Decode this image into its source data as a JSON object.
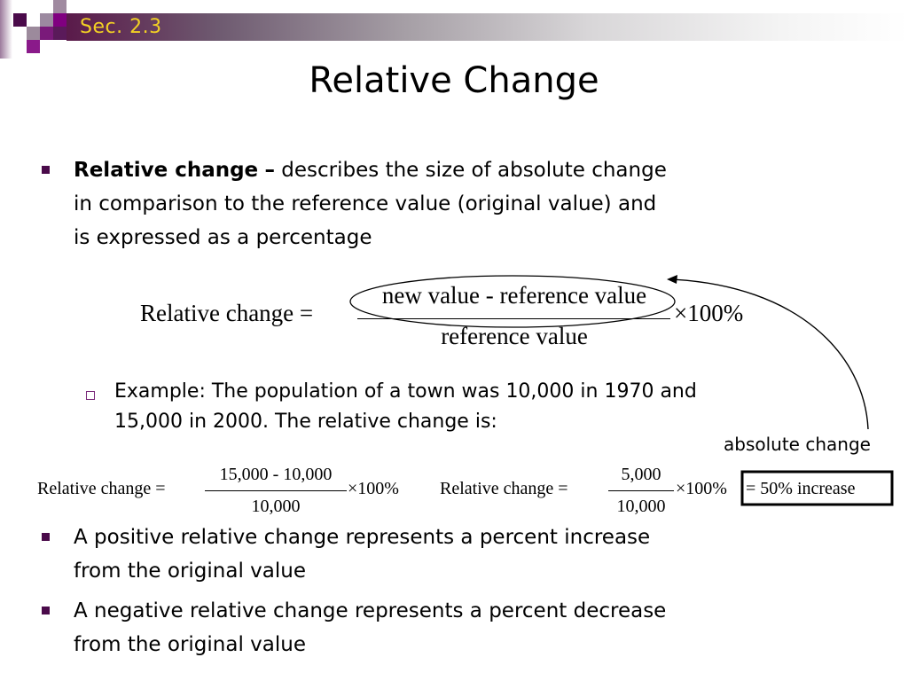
{
  "header": {
    "section_label": "Sec. 2.3",
    "colors": {
      "section_label": "#f2d024",
      "accent": "#4a0a4a"
    }
  },
  "title": "Relative Change",
  "definition": {
    "term": "Relative change",
    "dash": "–",
    "lines": [
      "describes the size of absolute change",
      "in comparison to the reference value (original value) and",
      "is expressed as a percentage"
    ]
  },
  "formula": {
    "lhs": "Relative change =",
    "numerator": "new value - reference value",
    "denominator": "reference value",
    "multiplier": "×100%",
    "annotation": "absolute change"
  },
  "example": {
    "lines": [
      "Example: The population of a town was 10,000 in 1970 and",
      "15,000 in 2000.  The relative change is:"
    ],
    "step1": {
      "lhs": "Relative change =",
      "numerator": "15,000 - 10,000",
      "denominator": "10,000",
      "multiplier": "×100%"
    },
    "step2": {
      "lhs": "Relative change =",
      "numerator": "5,000",
      "denominator": "10,000",
      "multiplier": "×100%",
      "result": "= 50% increase"
    }
  },
  "bullets": [
    {
      "lines": [
        "A positive relative change represents a percent increase",
        "from the original value"
      ]
    },
    {
      "lines": [
        "A negative relative change represents a percent decrease",
        "from the original value"
      ]
    }
  ]
}
